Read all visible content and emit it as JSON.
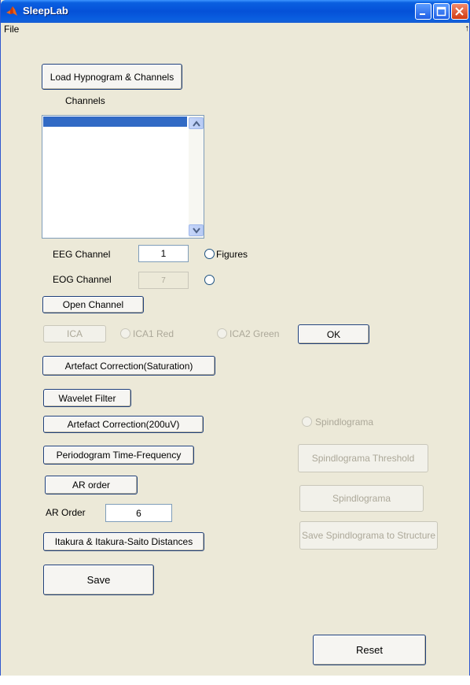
{
  "window": {
    "title": "SleepLab",
    "menu": {
      "file": "File",
      "overflow_arrow": "↑"
    }
  },
  "controls": {
    "load_button": "Load Hypnogram & Channels",
    "channels_label": "Channels",
    "eeg_channel_label": "EEG Channel",
    "eeg_channel_value": "1",
    "figures_radio": "Figures",
    "eog_channel_label": "EOG Channel",
    "eog_channel_value": "7",
    "open_channel_button": "Open Channel",
    "ica_button": "ICA",
    "ica1_red_radio": "ICA1 Red",
    "ica2_green_radio": "ICA2 Green",
    "ok_button": "OK",
    "artefact_saturation_button": "Artefact Correction(Saturation)",
    "wavelet_filter_button": "Wavelet Filter",
    "artefact_200uv_button": "Artefact Correction(200uV)",
    "periodogram_button": "Periodogram Time-Frequency",
    "ar_order_button": "AR order",
    "ar_order_label": "AR Order",
    "ar_order_value": "6",
    "itakura_button": "Itakura & Itakura-Saito Distances",
    "save_button": "Save",
    "spindlograma_radio": "Spindlograma",
    "spindlograma_threshold_button": "Spindlograma Threshold",
    "spindlograma_button": "Spindlograma",
    "save_spindlograma_button": "Save Spindlograma to Structure",
    "reset_button": "Reset"
  }
}
